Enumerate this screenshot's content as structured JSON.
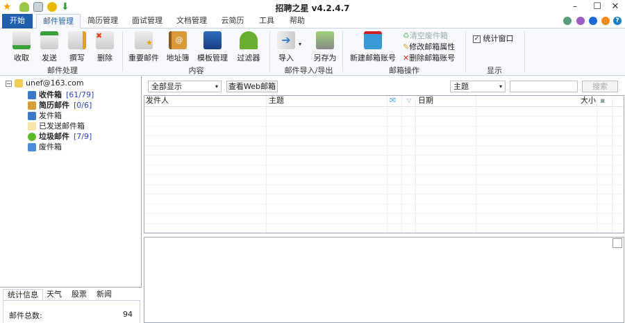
{
  "window": {
    "title": "招聘之星 v4.2.4.7",
    "minimize": "–",
    "maximize": "☐",
    "close": "✕"
  },
  "tabs": [
    {
      "label": "开始"
    },
    {
      "label": "邮件管理"
    },
    {
      "label": "简历管理"
    },
    {
      "label": "面试管理"
    },
    {
      "label": "文档管理"
    },
    {
      "label": "云简历"
    },
    {
      "label": "工具"
    },
    {
      "label": "帮助"
    }
  ],
  "theme_colors": [
    "#5a9c77",
    "#a05cc0",
    "#1c6bd4",
    "#f08a1e",
    "#1a7fc4"
  ],
  "help_label": "?",
  "ribbon": {
    "groups": [
      {
        "label": "邮件处理",
        "buttons": [
          "收取",
          "发送",
          "撰写",
          "删除"
        ]
      },
      {
        "label": "内容",
        "buttons": [
          "重要邮件",
          "地址簿",
          "模板管理",
          "过滤器"
        ]
      },
      {
        "label": "邮件导入/导出",
        "buttons": [
          "导入",
          "另存为"
        ]
      },
      {
        "label": "邮箱操作",
        "buttons": [
          "新建邮箱账号"
        ],
        "small": [
          "清空废件箱",
          "修改邮箱属性",
          "删除邮箱账号"
        ]
      },
      {
        "label": "显示",
        "checkbox": "统计窗口",
        "checked": true
      }
    ]
  },
  "tree": {
    "account": "unef@163.com",
    "folders": [
      {
        "label": "收件箱",
        "count": "[61/79]",
        "bold": true
      },
      {
        "label": "简历邮件",
        "count": "[0/6]",
        "bold": true
      },
      {
        "label": "发件箱",
        "count": ""
      },
      {
        "label": "已发送邮件箱",
        "count": ""
      },
      {
        "label": "垃圾邮件",
        "count": "[7/9]",
        "bold": true
      },
      {
        "label": "废件箱",
        "count": ""
      }
    ]
  },
  "bottom_tabs": [
    "统计信息",
    "天气",
    "股票",
    "新闻"
  ],
  "stats": {
    "label": "邮件总数:",
    "value": "94"
  },
  "toolbar": {
    "filter": "全部显示",
    "web_button": "查看Web邮箱",
    "search_field": "主题",
    "search_value": "",
    "search_button": "搜索"
  },
  "grid": {
    "columns": [
      "发件人",
      "主题",
      "日期",
      "大小"
    ]
  }
}
